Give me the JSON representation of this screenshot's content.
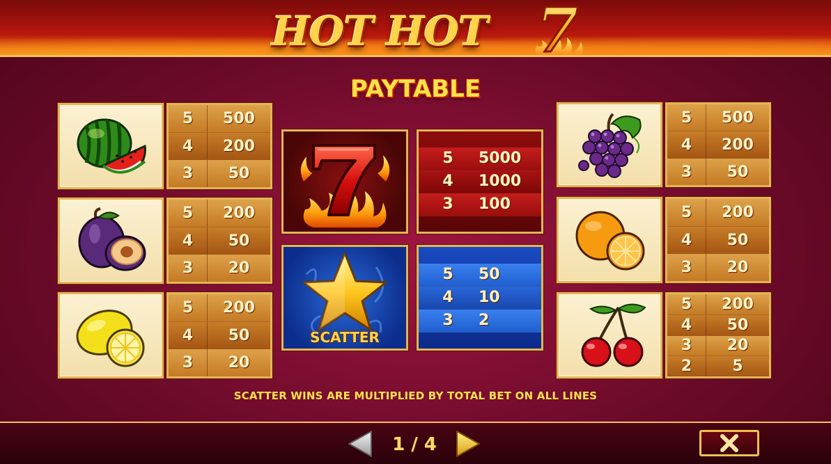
{
  "header": {
    "logo_text": "HOT HOT",
    "logo_number": "7"
  },
  "title": "PAYTABLE",
  "left_symbols": [
    {
      "icon": "watermelon-icon",
      "pays": [
        {
          "count": "5",
          "value": "500"
        },
        {
          "count": "4",
          "value": "200"
        },
        {
          "count": "3",
          "value": "50"
        }
      ]
    },
    {
      "icon": "plum-icon",
      "pays": [
        {
          "count": "5",
          "value": "200"
        },
        {
          "count": "4",
          "value": "50"
        },
        {
          "count": "3",
          "value": "20"
        }
      ]
    },
    {
      "icon": "lemon-icon",
      "pays": [
        {
          "count": "5",
          "value": "200"
        },
        {
          "count": "4",
          "value": "50"
        },
        {
          "count": "3",
          "value": "20"
        }
      ]
    }
  ],
  "center_symbols": [
    {
      "icon": "fire-seven-icon",
      "pays": [
        {
          "count": "5",
          "value": "5000"
        },
        {
          "count": "4",
          "value": "1000"
        },
        {
          "count": "3",
          "value": "100"
        }
      ]
    },
    {
      "icon": "star-scatter-icon",
      "label": "SCATTER",
      "pays": [
        {
          "count": "5",
          "value": "50"
        },
        {
          "count": "4",
          "value": "10"
        },
        {
          "count": "3",
          "value": "2"
        }
      ]
    }
  ],
  "right_symbols": [
    {
      "icon": "grapes-icon",
      "pays": [
        {
          "count": "5",
          "value": "500"
        },
        {
          "count": "4",
          "value": "200"
        },
        {
          "count": "3",
          "value": "50"
        }
      ]
    },
    {
      "icon": "orange-icon",
      "pays": [
        {
          "count": "5",
          "value": "200"
        },
        {
          "count": "4",
          "value": "50"
        },
        {
          "count": "3",
          "value": "20"
        }
      ]
    },
    {
      "icon": "cherries-icon",
      "pays": [
        {
          "count": "5",
          "value": "200"
        },
        {
          "count": "4",
          "value": "50"
        },
        {
          "count": "3",
          "value": "20"
        },
        {
          "count": "2",
          "value": "5"
        }
      ]
    }
  ],
  "note": "SCATTER WINS ARE MULTIPLIED BY TOTAL BET ON ALL LINES",
  "footer": {
    "page": "1 / 4",
    "close_icon": "close-icon",
    "prev_icon": "arrow-left-icon",
    "next_icon": "arrow-right-icon"
  },
  "colors": {
    "accent_gold": "#f4c25a",
    "title_yellow": "#ffe14a",
    "background": "#8a1238"
  }
}
